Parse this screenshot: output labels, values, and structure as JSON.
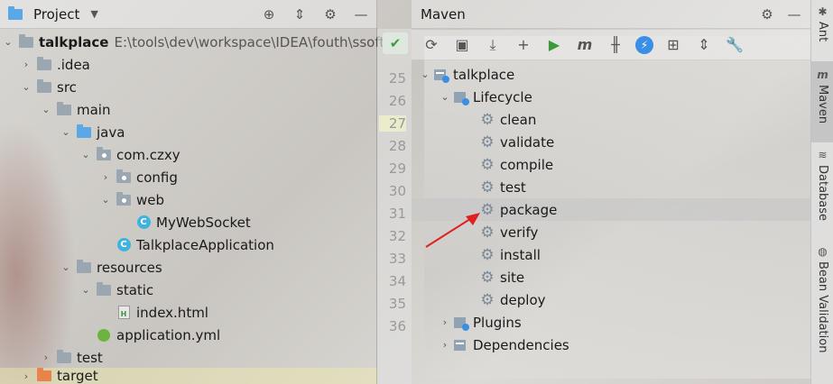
{
  "project_panel": {
    "title": "Project",
    "tree": [
      {
        "label": "talkplace",
        "path": "E:\\tools\\dev\\workspace\\IDEA\\fouth\\ssoft\\"
      },
      {
        "label": ".idea"
      },
      {
        "label": "src"
      },
      {
        "label": "main"
      },
      {
        "label": "java"
      },
      {
        "label": "com.czxy"
      },
      {
        "label": "config"
      },
      {
        "label": "web"
      },
      {
        "label": "MyWebSocket"
      },
      {
        "label": "TalkplaceApplication"
      },
      {
        "label": "resources"
      },
      {
        "label": "static"
      },
      {
        "label": "index.html"
      },
      {
        "label": "application.yml"
      },
      {
        "label": "test"
      },
      {
        "label": "target"
      }
    ]
  },
  "gutter": {
    "lines": [
      "25",
      "26",
      "27",
      "28",
      "29",
      "30",
      "31",
      "32",
      "33",
      "34",
      "35",
      "36"
    ]
  },
  "maven_panel": {
    "title": "Maven",
    "project": "talkplace",
    "lifecycle_label": "Lifecycle",
    "phases": [
      "clean",
      "validate",
      "compile",
      "test",
      "package",
      "verify",
      "install",
      "site",
      "deploy"
    ],
    "plugins_label": "Plugins",
    "dependencies_label": "Dependencies",
    "selected_phase": "package"
  },
  "right_sidebar": {
    "tabs": [
      "Ant",
      "Maven",
      "Database",
      "Bean Validation"
    ]
  },
  "colors": {
    "run_green": "#3a9a3a",
    "accent_blue": "#3a8ee6",
    "annotation_red": "#e02020"
  }
}
